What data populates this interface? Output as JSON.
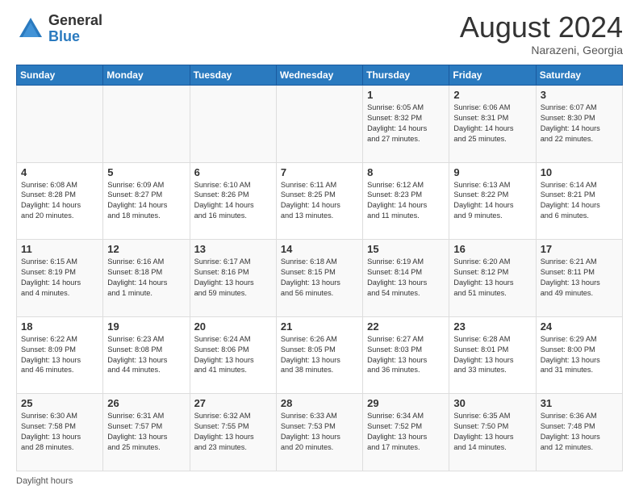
{
  "logo": {
    "general": "General",
    "blue": "Blue"
  },
  "header": {
    "month": "August 2024",
    "location": "Narazeni, Georgia"
  },
  "days_of_week": [
    "Sunday",
    "Monday",
    "Tuesday",
    "Wednesday",
    "Thursday",
    "Friday",
    "Saturday"
  ],
  "footer": {
    "text": "Daylight hours"
  },
  "weeks": [
    [
      {
        "day": "",
        "info": ""
      },
      {
        "day": "",
        "info": ""
      },
      {
        "day": "",
        "info": ""
      },
      {
        "day": "",
        "info": ""
      },
      {
        "day": "1",
        "info": "Sunrise: 6:05 AM\nSunset: 8:32 PM\nDaylight: 14 hours\nand 27 minutes."
      },
      {
        "day": "2",
        "info": "Sunrise: 6:06 AM\nSunset: 8:31 PM\nDaylight: 14 hours\nand 25 minutes."
      },
      {
        "day": "3",
        "info": "Sunrise: 6:07 AM\nSunset: 8:30 PM\nDaylight: 14 hours\nand 22 minutes."
      }
    ],
    [
      {
        "day": "4",
        "info": "Sunrise: 6:08 AM\nSunset: 8:28 PM\nDaylight: 14 hours\nand 20 minutes."
      },
      {
        "day": "5",
        "info": "Sunrise: 6:09 AM\nSunset: 8:27 PM\nDaylight: 14 hours\nand 18 minutes."
      },
      {
        "day": "6",
        "info": "Sunrise: 6:10 AM\nSunset: 8:26 PM\nDaylight: 14 hours\nand 16 minutes."
      },
      {
        "day": "7",
        "info": "Sunrise: 6:11 AM\nSunset: 8:25 PM\nDaylight: 14 hours\nand 13 minutes."
      },
      {
        "day": "8",
        "info": "Sunrise: 6:12 AM\nSunset: 8:23 PM\nDaylight: 14 hours\nand 11 minutes."
      },
      {
        "day": "9",
        "info": "Sunrise: 6:13 AM\nSunset: 8:22 PM\nDaylight: 14 hours\nand 9 minutes."
      },
      {
        "day": "10",
        "info": "Sunrise: 6:14 AM\nSunset: 8:21 PM\nDaylight: 14 hours\nand 6 minutes."
      }
    ],
    [
      {
        "day": "11",
        "info": "Sunrise: 6:15 AM\nSunset: 8:19 PM\nDaylight: 14 hours\nand 4 minutes."
      },
      {
        "day": "12",
        "info": "Sunrise: 6:16 AM\nSunset: 8:18 PM\nDaylight: 14 hours\nand 1 minute."
      },
      {
        "day": "13",
        "info": "Sunrise: 6:17 AM\nSunset: 8:16 PM\nDaylight: 13 hours\nand 59 minutes."
      },
      {
        "day": "14",
        "info": "Sunrise: 6:18 AM\nSunset: 8:15 PM\nDaylight: 13 hours\nand 56 minutes."
      },
      {
        "day": "15",
        "info": "Sunrise: 6:19 AM\nSunset: 8:14 PM\nDaylight: 13 hours\nand 54 minutes."
      },
      {
        "day": "16",
        "info": "Sunrise: 6:20 AM\nSunset: 8:12 PM\nDaylight: 13 hours\nand 51 minutes."
      },
      {
        "day": "17",
        "info": "Sunrise: 6:21 AM\nSunset: 8:11 PM\nDaylight: 13 hours\nand 49 minutes."
      }
    ],
    [
      {
        "day": "18",
        "info": "Sunrise: 6:22 AM\nSunset: 8:09 PM\nDaylight: 13 hours\nand 46 minutes."
      },
      {
        "day": "19",
        "info": "Sunrise: 6:23 AM\nSunset: 8:08 PM\nDaylight: 13 hours\nand 44 minutes."
      },
      {
        "day": "20",
        "info": "Sunrise: 6:24 AM\nSunset: 8:06 PM\nDaylight: 13 hours\nand 41 minutes."
      },
      {
        "day": "21",
        "info": "Sunrise: 6:26 AM\nSunset: 8:05 PM\nDaylight: 13 hours\nand 38 minutes."
      },
      {
        "day": "22",
        "info": "Sunrise: 6:27 AM\nSunset: 8:03 PM\nDaylight: 13 hours\nand 36 minutes."
      },
      {
        "day": "23",
        "info": "Sunrise: 6:28 AM\nSunset: 8:01 PM\nDaylight: 13 hours\nand 33 minutes."
      },
      {
        "day": "24",
        "info": "Sunrise: 6:29 AM\nSunset: 8:00 PM\nDaylight: 13 hours\nand 31 minutes."
      }
    ],
    [
      {
        "day": "25",
        "info": "Sunrise: 6:30 AM\nSunset: 7:58 PM\nDaylight: 13 hours\nand 28 minutes."
      },
      {
        "day": "26",
        "info": "Sunrise: 6:31 AM\nSunset: 7:57 PM\nDaylight: 13 hours\nand 25 minutes."
      },
      {
        "day": "27",
        "info": "Sunrise: 6:32 AM\nSunset: 7:55 PM\nDaylight: 13 hours\nand 23 minutes."
      },
      {
        "day": "28",
        "info": "Sunrise: 6:33 AM\nSunset: 7:53 PM\nDaylight: 13 hours\nand 20 minutes."
      },
      {
        "day": "29",
        "info": "Sunrise: 6:34 AM\nSunset: 7:52 PM\nDaylight: 13 hours\nand 17 minutes."
      },
      {
        "day": "30",
        "info": "Sunrise: 6:35 AM\nSunset: 7:50 PM\nDaylight: 13 hours\nand 14 minutes."
      },
      {
        "day": "31",
        "info": "Sunrise: 6:36 AM\nSunset: 7:48 PM\nDaylight: 13 hours\nand 12 minutes."
      }
    ]
  ]
}
